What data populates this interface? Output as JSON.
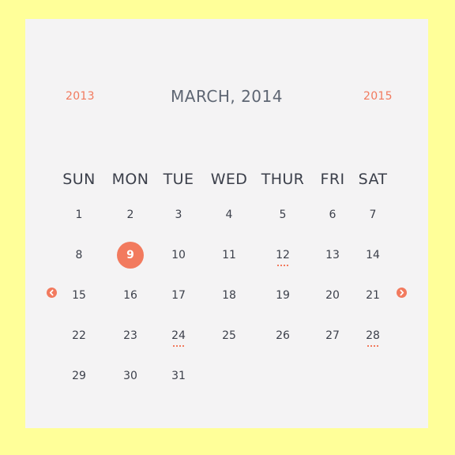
{
  "theme": {
    "accent": "#f27a5e",
    "title_color": "#5e6673",
    "text_color": "#3b3f4a",
    "card_bg": "#f4f3f4",
    "page_bg": "#ffff99"
  },
  "calendar": {
    "prev_year": "2013",
    "next_year": "2015",
    "title": "MARCH, 2014",
    "prev_month_icon": "chevron-left-icon",
    "next_month_icon": "chevron-right-icon",
    "weekdays": [
      "SUN",
      "MON",
      "TUE",
      "WED",
      "THUR",
      "FRI",
      "SAT"
    ],
    "selected_day": "9",
    "event_days": [
      "12",
      "24",
      "28"
    ],
    "weeks": [
      [
        "1",
        "2",
        "3",
        "4",
        "5",
        "6",
        "7"
      ],
      [
        "8",
        "9",
        "10",
        "11",
        "12",
        "13",
        "14"
      ],
      [
        "15",
        "16",
        "17",
        "18",
        "19",
        "20",
        "21"
      ],
      [
        "22",
        "23",
        "24",
        "25",
        "26",
        "27",
        "28"
      ],
      [
        "29",
        "30",
        "31",
        "",
        "",
        "",
        ""
      ]
    ]
  }
}
